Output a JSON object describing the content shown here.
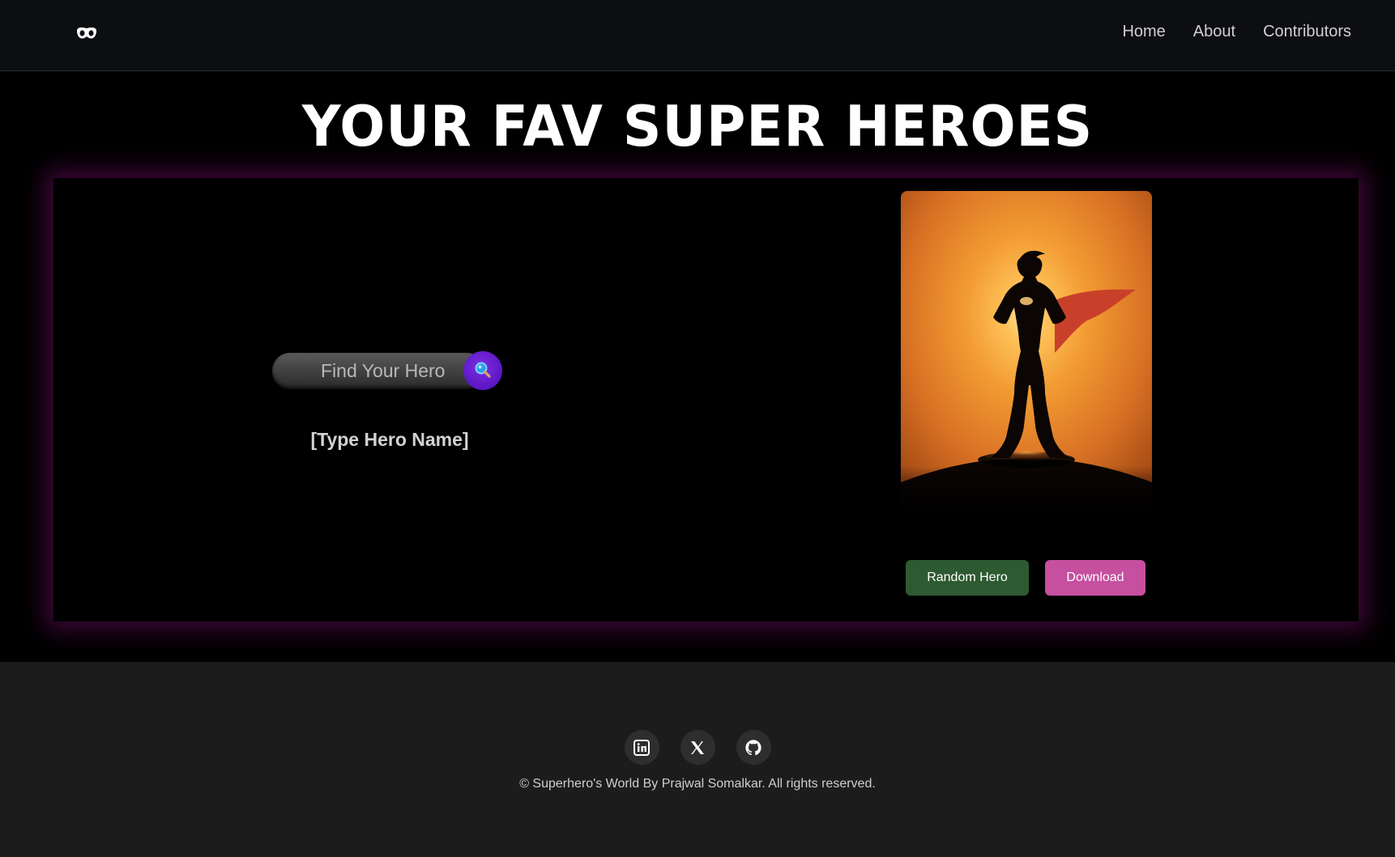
{
  "nav": {
    "logo": "mask-icon",
    "links": [
      "Home",
      "About",
      "Contributors"
    ]
  },
  "main": {
    "title": "YOUR FAV SUPER HEROES",
    "search": {
      "placeholder": "Find Your Hero",
      "value": "",
      "button_icon": "search-icon"
    },
    "hero_name": "[Type Hero Name]",
    "image": "superhero-silhouette",
    "buttons": {
      "random": "Random Hero",
      "download": "Download"
    }
  },
  "footer": {
    "social": [
      "linkedin-icon",
      "x-icon",
      "github-icon"
    ],
    "copyright": "© Superhero's World By Prajwal Somalkar. All rights reserved."
  },
  "colors": {
    "search_button": "#5b16c4",
    "random_button": "#2e5a31",
    "download_button": "#c64f9f",
    "card_glow": "#5f0a55"
  }
}
